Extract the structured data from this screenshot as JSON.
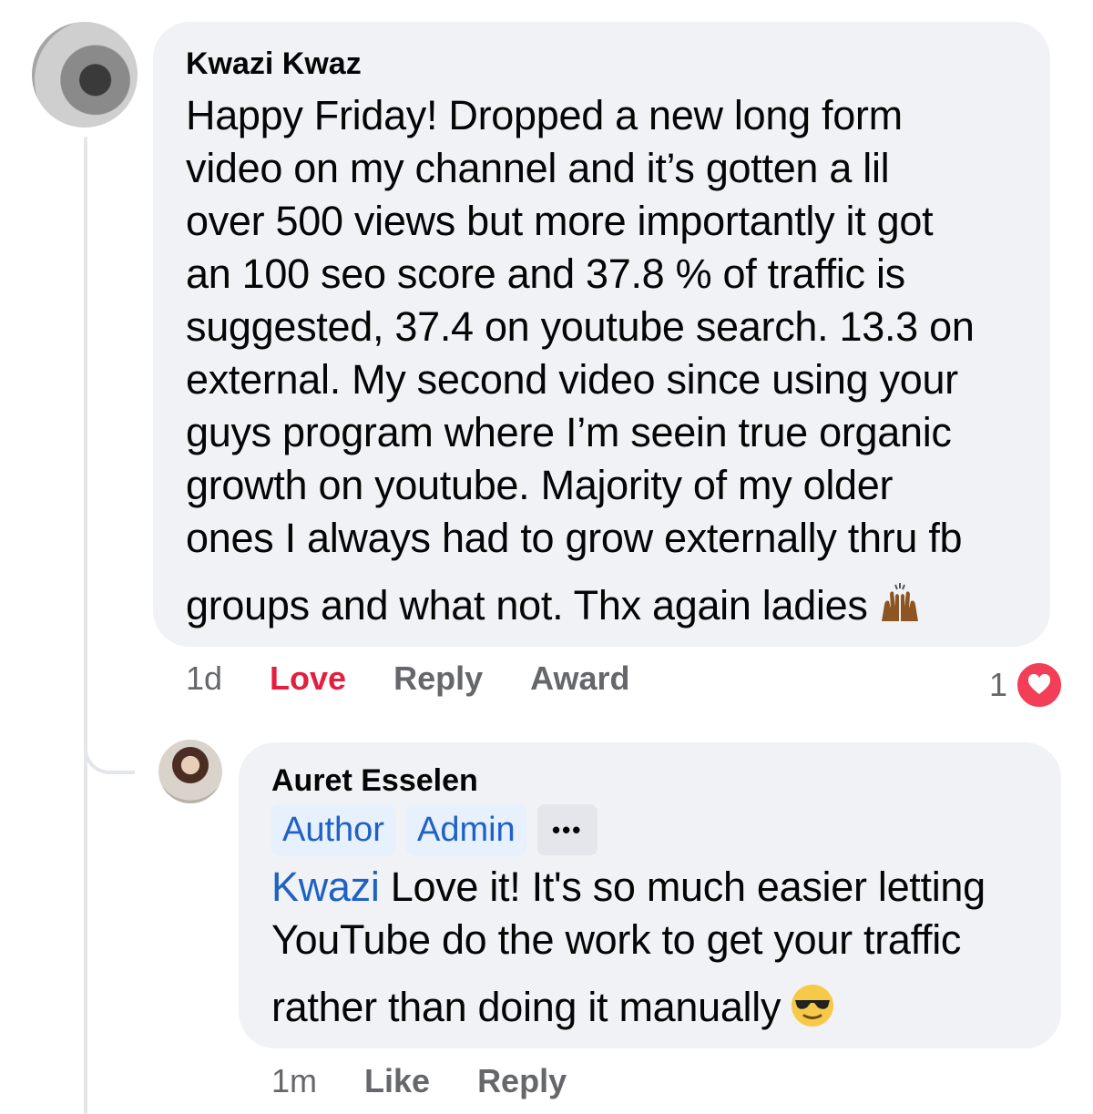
{
  "comment": {
    "author": "Kwazi Kwaz",
    "lines": [
      "Happy Friday! Dropped a new long form",
      "video on my channel and it’s gotten a lil",
      "over 500 views but more importantly it got",
      "an 100 seo score and 37.8 % of traffic is",
      "suggested, 37.4 on youtube search. 13.3 on",
      "external.  My second video since using your",
      "guys program where I’m seein true organic",
      "growth on youtube.  Majority of my older",
      "ones I always had to grow externally thru fb",
      "groups and what not.  Thx again ladies"
    ],
    "emoji": "raising-hands-emoji",
    "timestamp": "1d",
    "love_label": "Love",
    "reply_label": "Reply",
    "award_label": "Award",
    "reaction_count": "1",
    "reaction_color": "#f33e58"
  },
  "reply": {
    "author": "Auret Esselen",
    "badges": [
      "Author",
      "Admin"
    ],
    "more_label": "•••",
    "mention": "Kwazi",
    "lines": [
      " Love it! It's so much easier letting",
      "YouTube do the work to get your traffic",
      "rather than doing it manually"
    ],
    "emoji": "sunglasses-emoji",
    "timestamp": "1m",
    "like_label": "Like",
    "reply_label": "Reply"
  },
  "colors": {
    "bubble": "#f0f2f5",
    "link": "#1f62c4",
    "love": "#e41e3f",
    "meta": "#65676b"
  }
}
